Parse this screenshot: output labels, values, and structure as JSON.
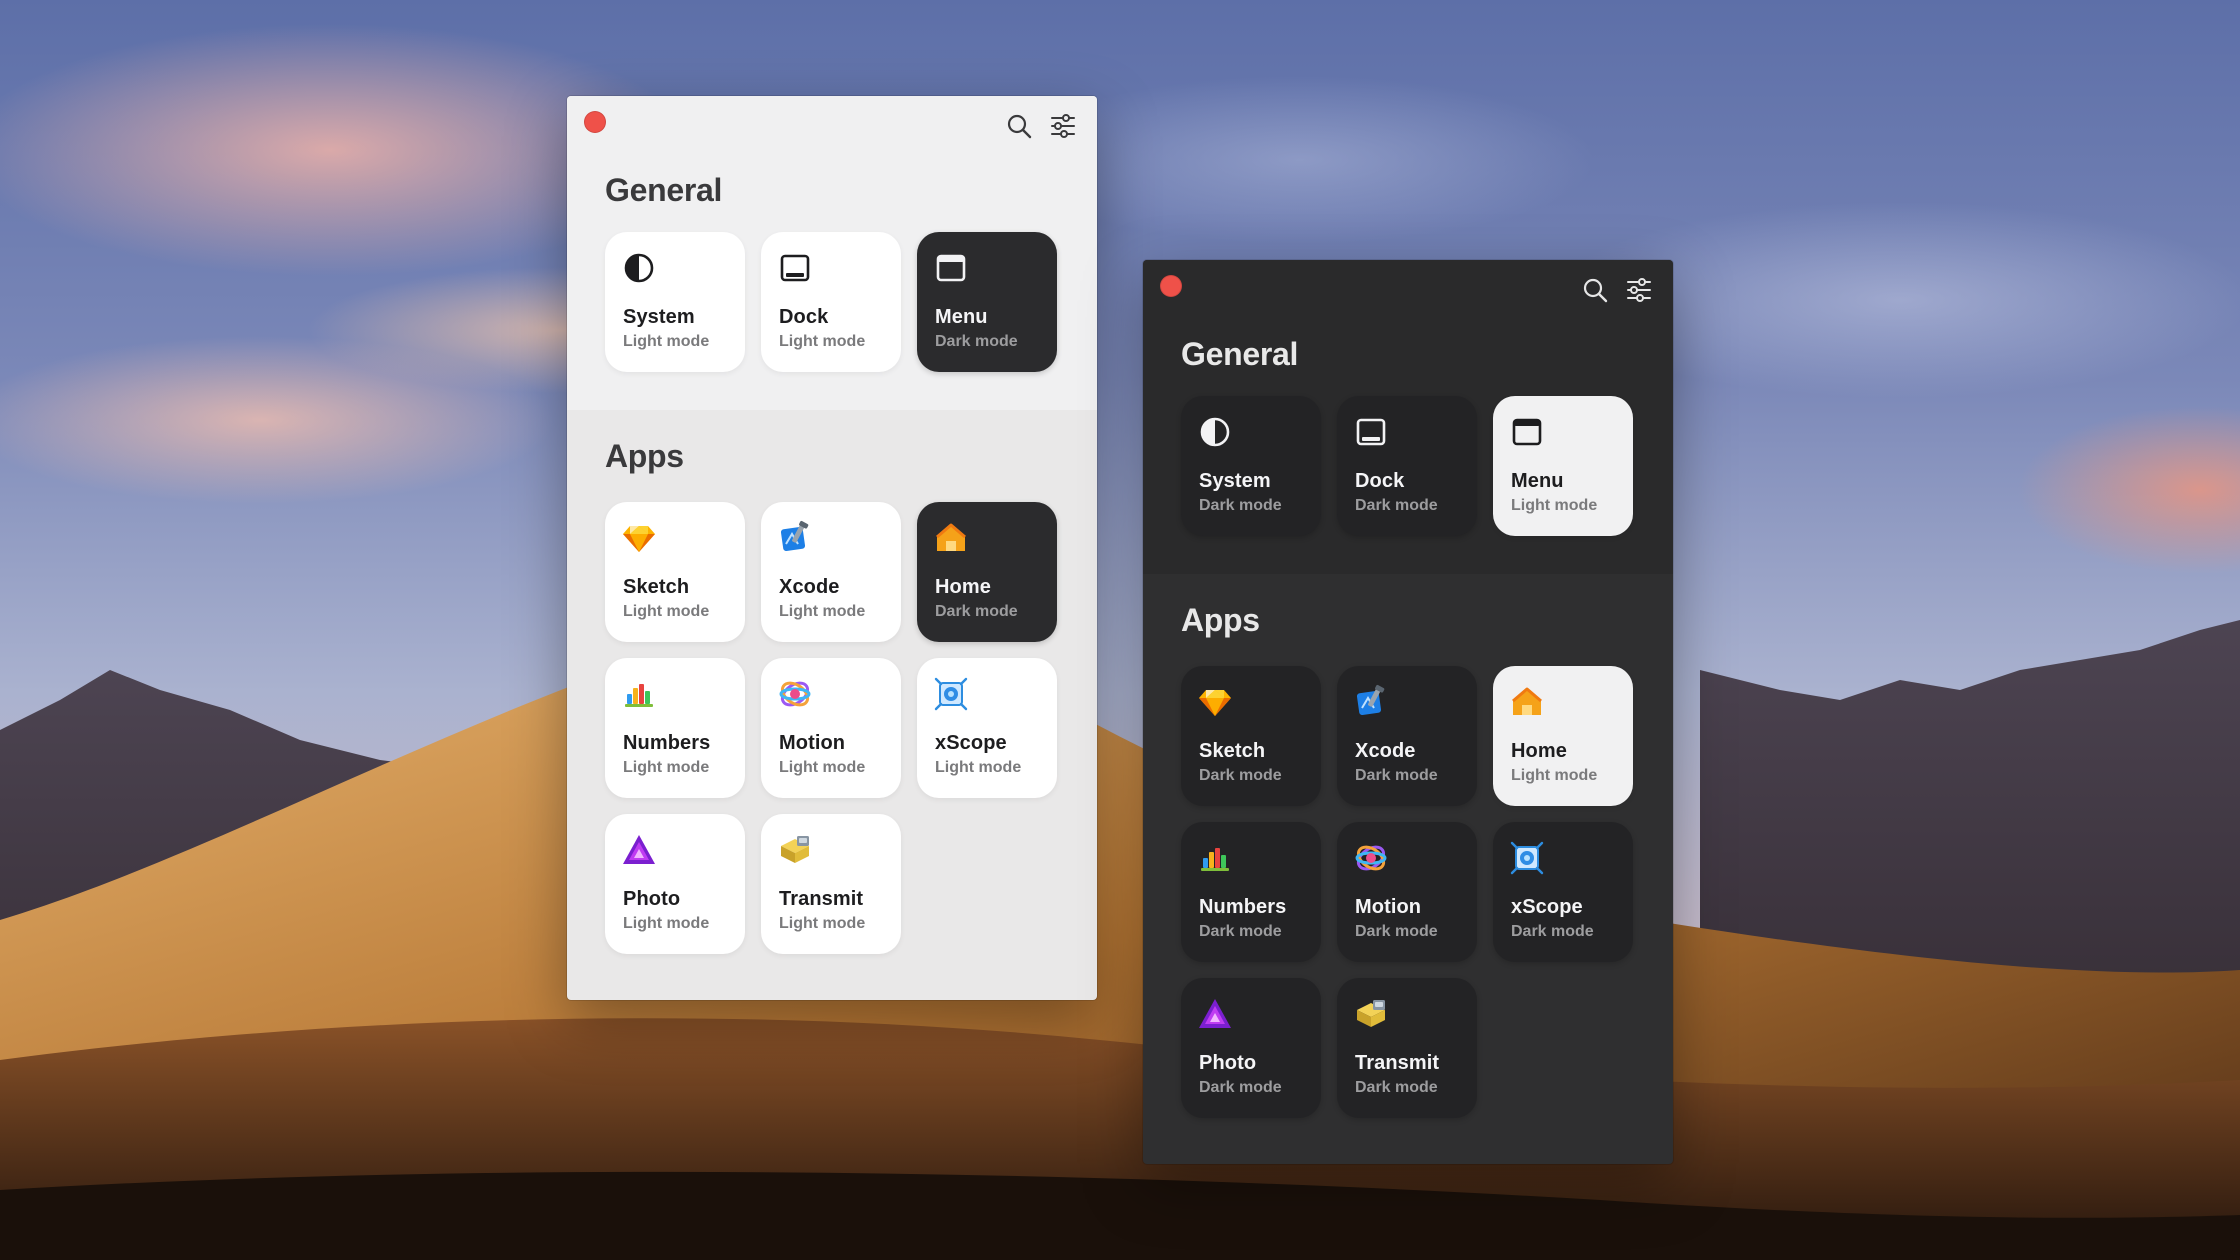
{
  "windows": [
    {
      "theme": "light",
      "toolbar": {
        "search_icon": "search-icon",
        "settings_icon": "sliders-icon"
      },
      "general": {
        "title": "General",
        "items": [
          {
            "id": "system",
            "name": "System",
            "mode": "Light mode",
            "icon": "half-circle-icon",
            "tile": "light"
          },
          {
            "id": "dock",
            "name": "Dock",
            "mode": "Light mode",
            "icon": "dock-icon",
            "tile": "light"
          },
          {
            "id": "menu",
            "name": "Menu",
            "mode": "Dark mode",
            "icon": "menubar-icon",
            "tile": "dark"
          }
        ]
      },
      "apps": {
        "title": "Apps",
        "items": [
          {
            "id": "sketch",
            "name": "Sketch",
            "mode": "Light mode",
            "icon": "sketch-icon",
            "tile": "light"
          },
          {
            "id": "xcode",
            "name": "Xcode",
            "mode": "Light mode",
            "icon": "xcode-icon",
            "tile": "light"
          },
          {
            "id": "home",
            "name": "Home",
            "mode": "Dark mode",
            "icon": "home-icon",
            "tile": "dark"
          },
          {
            "id": "numbers",
            "name": "Numbers",
            "mode": "Light mode",
            "icon": "numbers-icon",
            "tile": "light"
          },
          {
            "id": "motion",
            "name": "Motion",
            "mode": "Light mode",
            "icon": "motion-icon",
            "tile": "light"
          },
          {
            "id": "xscope",
            "name": "xScope",
            "mode": "Light mode",
            "icon": "xscope-icon",
            "tile": "light"
          },
          {
            "id": "photo",
            "name": "Photo",
            "mode": "Light mode",
            "icon": "photo-icon",
            "tile": "light"
          },
          {
            "id": "transmit",
            "name": "Transmit",
            "mode": "Light mode",
            "icon": "transmit-icon",
            "tile": "light"
          }
        ]
      }
    },
    {
      "theme": "dark",
      "toolbar": {
        "search_icon": "search-icon",
        "settings_icon": "sliders-icon"
      },
      "general": {
        "title": "General",
        "items": [
          {
            "id": "system",
            "name": "System",
            "mode": "Dark mode",
            "icon": "half-circle-icon",
            "tile": "dark"
          },
          {
            "id": "dock",
            "name": "Dock",
            "mode": "Dark mode",
            "icon": "dock-icon",
            "tile": "dark"
          },
          {
            "id": "menu",
            "name": "Menu",
            "mode": "Light mode",
            "icon": "menubar-icon",
            "tile": "light"
          }
        ]
      },
      "apps": {
        "title": "Apps",
        "items": [
          {
            "id": "sketch",
            "name": "Sketch",
            "mode": "Dark mode",
            "icon": "sketch-icon",
            "tile": "dark"
          },
          {
            "id": "xcode",
            "name": "Xcode",
            "mode": "Dark mode",
            "icon": "xcode-icon",
            "tile": "dark"
          },
          {
            "id": "home",
            "name": "Home",
            "mode": "Light mode",
            "icon": "home-icon",
            "tile": "light"
          },
          {
            "id": "numbers",
            "name": "Numbers",
            "mode": "Dark mode",
            "icon": "numbers-icon",
            "tile": "dark"
          },
          {
            "id": "motion",
            "name": "Motion",
            "mode": "Dark mode",
            "icon": "motion-icon",
            "tile": "dark"
          },
          {
            "id": "xscope",
            "name": "xScope",
            "mode": "Dark mode",
            "icon": "xscope-icon",
            "tile": "dark"
          },
          {
            "id": "photo",
            "name": "Photo",
            "mode": "Dark mode",
            "icon": "photo-icon",
            "tile": "dark"
          },
          {
            "id": "transmit",
            "name": "Transmit",
            "mode": "Dark mode",
            "icon": "transmit-icon",
            "tile": "dark"
          }
        ]
      }
    }
  ],
  "colors": {
    "close_button": "#ef5149",
    "light_window_bg": "#f0f0f1",
    "dark_window_bg": "#2a2a2b"
  }
}
